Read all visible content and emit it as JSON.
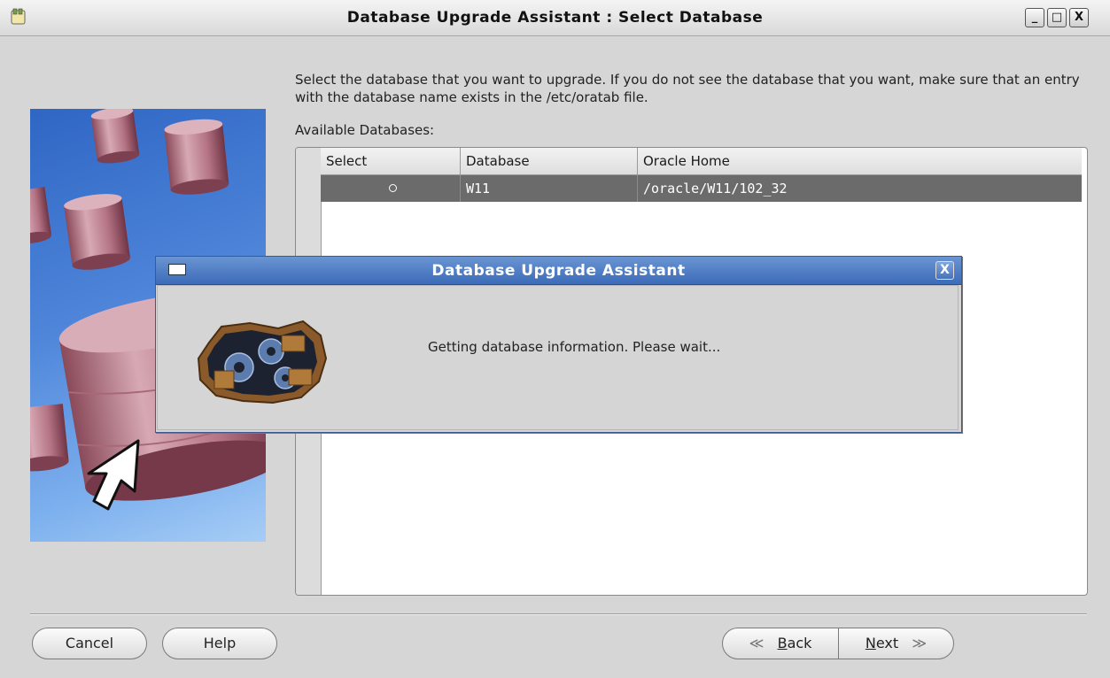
{
  "window": {
    "title": "Database Upgrade Assistant : Select Database",
    "controls": {
      "minimize": "_",
      "maximize": "□",
      "close": "X"
    }
  },
  "instruction": "Select the database that you want to upgrade. If you do not see the database that you want, make sure that an entry with the database name exists in the /etc/oratab file.",
  "available_label": "Available Databases:",
  "table": {
    "headers": [
      "Select",
      "Database",
      "Oracle Home"
    ],
    "rows": [
      {
        "select": "radio-unselected",
        "database": "W11",
        "oracle_home": "/oracle/W11/102_32"
      }
    ]
  },
  "buttons": {
    "cancel": "Cancel",
    "help": "Help",
    "back_arrow": "≪",
    "back_u": "B",
    "back_rest": "ack",
    "next_u": "N",
    "next_rest": "ext",
    "next_arrow": "≫"
  },
  "dialog": {
    "title": "Database Upgrade Assistant",
    "close": "X",
    "message": "Getting database information. Please wait..."
  },
  "colors": {
    "title_gradient_top": "#6a95d3",
    "title_gradient_bottom": "#3c6bb8",
    "selected_row": "#6b6b6b",
    "illustration_blue": "#4f86da"
  }
}
